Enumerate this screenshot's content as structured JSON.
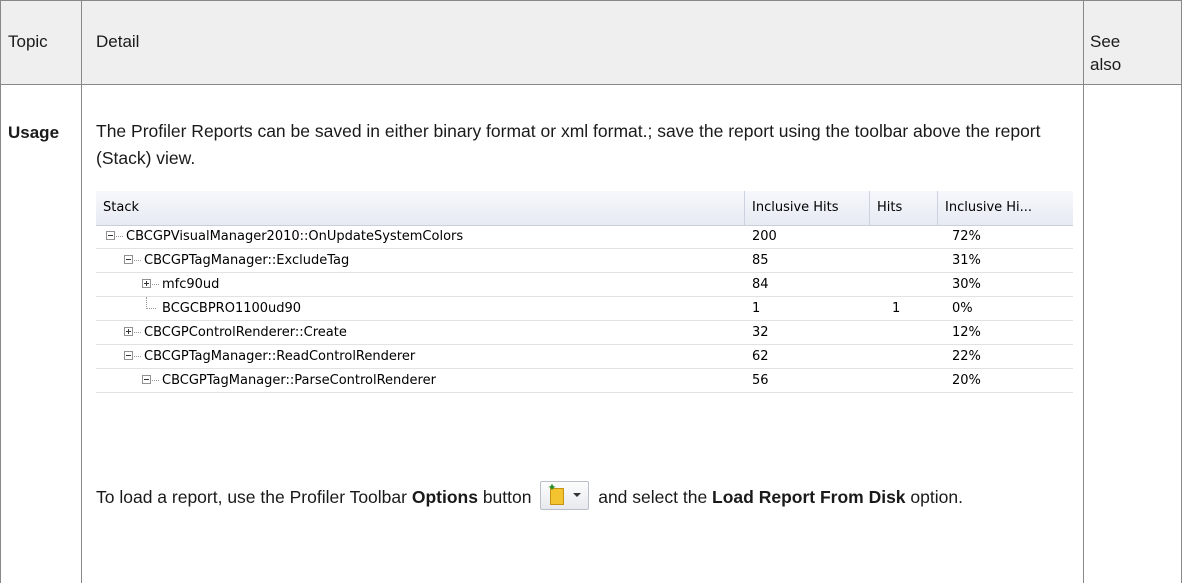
{
  "table": {
    "headers": {
      "topic": "Topic",
      "detail": "Detail",
      "see_also": "See also"
    },
    "row": {
      "topic": "Usage",
      "intro": "The Profiler Reports can be saved in either binary format or xml format.; save the report using the toolbar above the report (Stack) view.",
      "load_text_1": "To load a report, use the Profiler Toolbar ",
      "options_bold": "Options",
      "load_text_2": " button ",
      "load_text_3": " and select the ",
      "load_bold": "Load Report From Disk",
      "load_text_4": " option."
    }
  },
  "stack_view": {
    "columns": [
      "Stack",
      "Inclusive Hits",
      "Hits",
      "Inclusive Hi..."
    ],
    "rows": [
      {
        "name": "CBCGPVisualManager2010::OnUpdateSystemColors",
        "inclusive_hits": "200",
        "hits": "",
        "inclusive_pct": "72%",
        "depth": 0,
        "node": "minus"
      },
      {
        "name": "CBCGPTagManager::ExcludeTag",
        "inclusive_hits": "85",
        "hits": "",
        "inclusive_pct": "31%",
        "depth": 1,
        "node": "minus"
      },
      {
        "name": "mfc90ud",
        "inclusive_hits": "84",
        "hits": "",
        "inclusive_pct": "30%",
        "depth": 2,
        "node": "plus"
      },
      {
        "name": "BCGCBPRO1100ud90",
        "inclusive_hits": "1",
        "hits": "1",
        "inclusive_pct": "0%",
        "depth": 2,
        "node": "leaf"
      },
      {
        "name": "CBCGPControlRenderer::Create",
        "inclusive_hits": "32",
        "hits": "",
        "inclusive_pct": "12%",
        "depth": 1,
        "node": "plus"
      },
      {
        "name": "CBCGPTagManager::ReadControlRenderer",
        "inclusive_hits": "62",
        "hits": "",
        "inclusive_pct": "22%",
        "depth": 1,
        "node": "minus"
      },
      {
        "name": "CBCGPTagManager::ParseControlRenderer",
        "inclusive_hits": "56",
        "hits": "",
        "inclusive_pct": "20%",
        "depth": 2,
        "node": "minus"
      }
    ]
  },
  "icons": {
    "options_button": "new-folder-dropdown-icon"
  }
}
